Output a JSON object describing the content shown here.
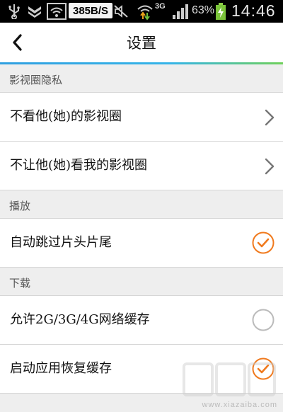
{
  "status_bar": {
    "network_speed": "385B/S",
    "network_type": "3G",
    "battery_percent": "63%",
    "time": "14:46",
    "icons": [
      "usb-icon",
      "shield-icon",
      "wifi-icon",
      "mute-icon",
      "data-transfer-icon",
      "signal-icon",
      "battery-charging-icon"
    ]
  },
  "header": {
    "title": "设置",
    "back_icon": "chevron-left-icon"
  },
  "colors": {
    "accent_start": "#2f9fe0",
    "accent_end": "#6fd05a",
    "check_orange": "#f07a1e",
    "radio_off": "#bbbbbb"
  },
  "sections": [
    {
      "header": "影视圈隐私",
      "items": [
        {
          "label": "不看他(她)的影视圈",
          "control": "chevron-right-icon"
        },
        {
          "label": "不让他(她)看我的影视圈",
          "control": "chevron-right-icon"
        }
      ]
    },
    {
      "header": "播放",
      "items": [
        {
          "label": "自动跳过片头片尾",
          "control": "checkbox",
          "checked": true
        }
      ]
    },
    {
      "header": "下载",
      "items": [
        {
          "label": "允许2G/3G/4G网络缓存",
          "control": "checkbox",
          "checked": false
        },
        {
          "label": "启动应用恢复缓存",
          "control": "checkbox",
          "checked": true
        }
      ]
    }
  ],
  "watermark": {
    "url": "www.xiazaiba.com"
  }
}
